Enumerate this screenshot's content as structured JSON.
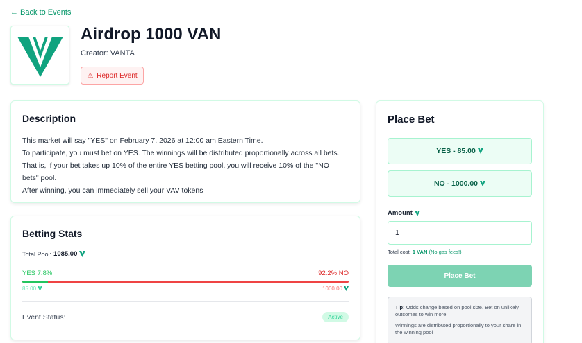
{
  "nav": {
    "back_label": "← Back to Events"
  },
  "event": {
    "title": "Airdrop 1000 VAN",
    "creator": "Creator: VANTA",
    "report_label": "Report Event",
    "brand_color": "#10a37f"
  },
  "description": {
    "heading": "Description",
    "lines": [
      "This market will say \"YES\" on February 7, 2026 at 12:00 am Eastern Time.",
      "To participate, you must bet on YES. The winnings will be distributed proportionally across all bets.",
      "That is, if your bet takes up 10% of the entire YES betting pool, you will receive 10% of the \"NO",
      "bets\" pool.",
      "After winning, you can immediately sell your VAV tokens"
    ]
  },
  "stats": {
    "heading": "Betting Stats",
    "total_pool_label": "Total Pool:",
    "total_pool_value": "1085.00",
    "yes_label": "YES 7.8%",
    "no_label": "92.2% NO",
    "yes_fraction": 0.078,
    "yes_amount": "85.00",
    "no_amount": "1000.00",
    "status_label": "Event Status:",
    "status_value": "Active"
  },
  "bet": {
    "heading": "Place Bet",
    "yes_option": "YES - 85.00",
    "no_option": "NO - 1000.00",
    "amount_label": "Amount",
    "amount_value": "1",
    "cost_prefix": "Total cost:",
    "cost_value": "1 VAN",
    "cost_suffix": "(No gas fees!)",
    "place_label": "Place Bet",
    "tip_title": "Tip:",
    "tip_line1": "Odds change based on pool size. Bet on unlikely outcomes to win more!",
    "tip_line2": "Winnings are distributed proportionally to your share in the winning pool"
  },
  "icons": {
    "currency": "vanta-v-icon",
    "warning": "warning-icon"
  }
}
